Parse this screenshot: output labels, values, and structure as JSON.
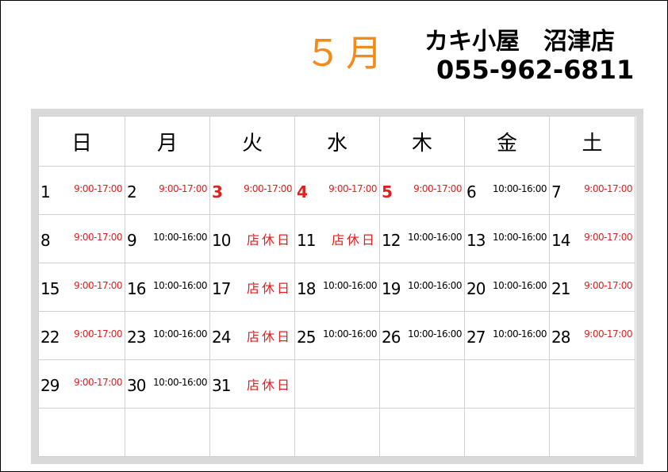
{
  "header": {
    "month": "５月",
    "shop_name": "カキ小屋　沼津店",
    "phone": "055-962-6811"
  },
  "weekdays": [
    "日",
    "月",
    "火",
    "水",
    "木",
    "金",
    "土"
  ],
  "weeks": [
    [
      {
        "day": "1",
        "hours": "9:00-17:00",
        "style": "red",
        "day_red": false
      },
      {
        "day": "2",
        "hours": "9:00-17:00",
        "style": "red",
        "day_red": false
      },
      {
        "day": "3",
        "hours": "9:00-17:00",
        "style": "red",
        "day_red": true
      },
      {
        "day": "4",
        "hours": "9:00-17:00",
        "style": "red",
        "day_red": true
      },
      {
        "day": "5",
        "hours": "9:00-17:00",
        "style": "red",
        "day_red": true
      },
      {
        "day": "6",
        "hours": "10:00-16:00",
        "style": "black",
        "day_red": false
      },
      {
        "day": "7",
        "hours": "9:00-17:00",
        "style": "red",
        "day_red": false
      }
    ],
    [
      {
        "day": "8",
        "hours": "9:00-17:00",
        "style": "red",
        "day_red": false
      },
      {
        "day": "9",
        "hours": "10:00-16:00",
        "style": "black",
        "day_red": false
      },
      {
        "day": "10",
        "hours": "店休日",
        "style": "closed",
        "day_red": false
      },
      {
        "day": "11",
        "hours": "店休日",
        "style": "closed",
        "day_red": false
      },
      {
        "day": "12",
        "hours": "10:00-16:00",
        "style": "black",
        "day_red": false
      },
      {
        "day": "13",
        "hours": "10:00-16:00",
        "style": "black",
        "day_red": false
      },
      {
        "day": "14",
        "hours": "9:00-17:00",
        "style": "red",
        "day_red": false
      }
    ],
    [
      {
        "day": "15",
        "hours": "9:00-17:00",
        "style": "red",
        "day_red": false
      },
      {
        "day": "16",
        "hours": "10:00-16:00",
        "style": "black",
        "day_red": false
      },
      {
        "day": "17",
        "hours": "店休日",
        "style": "closed",
        "day_red": false
      },
      {
        "day": "18",
        "hours": "10:00-16:00",
        "style": "black",
        "day_red": false
      },
      {
        "day": "19",
        "hours": "10:00-16:00",
        "style": "black",
        "day_red": false
      },
      {
        "day": "20",
        "hours": "10:00-16:00",
        "style": "black",
        "day_red": false
      },
      {
        "day": "21",
        "hours": "9:00-17:00",
        "style": "red",
        "day_red": false
      }
    ],
    [
      {
        "day": "22",
        "hours": "9:00-17:00",
        "style": "red",
        "day_red": false
      },
      {
        "day": "23",
        "hours": "10:00-16:00",
        "style": "black",
        "day_red": false
      },
      {
        "day": "24",
        "hours": "店休日",
        "style": "closed",
        "day_red": false
      },
      {
        "day": "25",
        "hours": "10:00-16:00",
        "style": "black",
        "day_red": false
      },
      {
        "day": "26",
        "hours": "10:00-16:00",
        "style": "black",
        "day_red": false
      },
      {
        "day": "27",
        "hours": "10:00-16:00",
        "style": "black",
        "day_red": false
      },
      {
        "day": "28",
        "hours": "9:00-17:00",
        "style": "red",
        "day_red": false
      }
    ],
    [
      {
        "day": "29",
        "hours": "9:00-17:00",
        "style": "red",
        "day_red": false
      },
      {
        "day": "30",
        "hours": "10:00-16:00",
        "style": "black",
        "day_red": false
      },
      {
        "day": "31",
        "hours": "店休日",
        "style": "closed",
        "day_red": false
      },
      {
        "day": "",
        "hours": "",
        "style": "black",
        "day_red": false
      },
      {
        "day": "",
        "hours": "",
        "style": "black",
        "day_red": false
      },
      {
        "day": "",
        "hours": "",
        "style": "black",
        "day_red": false
      },
      {
        "day": "",
        "hours": "",
        "style": "black",
        "day_red": false
      }
    ],
    [
      {
        "day": "",
        "hours": "",
        "style": "black",
        "day_red": false
      },
      {
        "day": "",
        "hours": "",
        "style": "black",
        "day_red": false
      },
      {
        "day": "",
        "hours": "",
        "style": "black",
        "day_red": false
      },
      {
        "day": "",
        "hours": "",
        "style": "black",
        "day_red": false
      },
      {
        "day": "",
        "hours": "",
        "style": "black",
        "day_red": false
      },
      {
        "day": "",
        "hours": "",
        "style": "black",
        "day_red": false
      },
      {
        "day": "",
        "hours": "",
        "style": "black",
        "day_red": false
      }
    ]
  ],
  "colors": {
    "month_orange": "#f08c1e",
    "open_red": "#e02020",
    "frame_gray": "#d9d9d9"
  }
}
